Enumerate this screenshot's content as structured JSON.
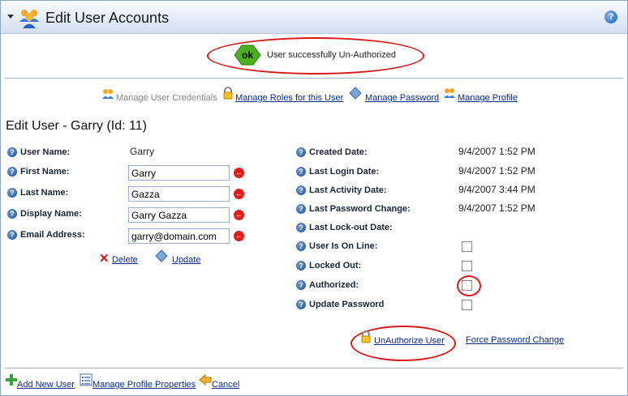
{
  "header": {
    "title": "Edit User Accounts",
    "help": "?"
  },
  "status": {
    "badge": "ok",
    "message": "User successfully Un-Authorized"
  },
  "toplinks": {
    "credentials": "Manage User Credentials",
    "roles": "Manage Roles for this User",
    "password": "Manage Password",
    "profile": "Manage Profile"
  },
  "edit_user": {
    "title": "Edit User - Garry (Id: 11)",
    "user_name_label": "User Name:",
    "user_name_value": "Garry",
    "first_name_label": "First Name:",
    "first_name_value": "Garry",
    "last_name_label": "Last Name:",
    "last_name_value": "Gazza",
    "display_name_label": "Display Name:",
    "display_name_value": "Garry Gazza",
    "email_label": "Email Address:",
    "email_value": "garry@domain.com",
    "delete": "Delete",
    "update": "Update"
  },
  "details": {
    "created_label": "Created Date:",
    "created_value": "9/4/2007 1:52 PM",
    "last_login_label": "Last Login Date:",
    "last_login_value": "9/4/2007 1:52 PM",
    "last_activity_label": "Last Activity Date:",
    "last_activity_value": "9/4/2007 3:44 PM",
    "last_pw_label": "Last Password Change:",
    "last_pw_value": "9/4/2007 1:52 PM",
    "lockout_label": "Last Lock-out Date:",
    "online_label": "User Is On Line:",
    "locked_label": "Locked Out:",
    "authorized_label": "Authorized:",
    "update_pw_label": "Update Password",
    "unauthorize": "UnAuthorize User",
    "force_pw": "Force Password Change"
  },
  "footer": {
    "add_user": "Add New User",
    "manage_profile_props": "Manage Profile Properties",
    "cancel": "Cancel"
  },
  "checkbox_states": {
    "online": false,
    "locked": false,
    "authorized": false,
    "update_password": false
  },
  "colors": {
    "highlight": "#d91a1a",
    "link": "#0a2a8a",
    "ok_badge": "#4caf1f"
  }
}
